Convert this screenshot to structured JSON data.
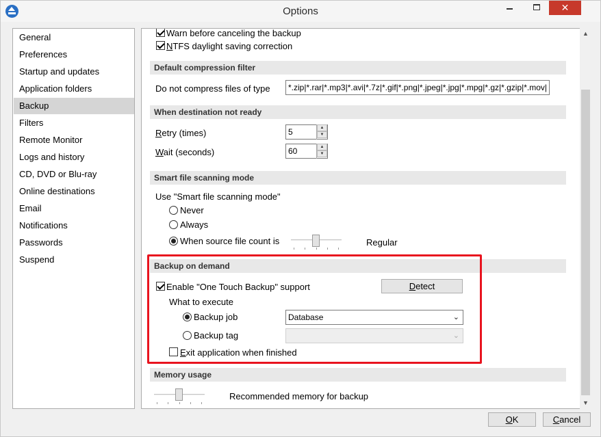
{
  "window": {
    "title": "Options"
  },
  "titlebar": {
    "minimize": "–",
    "maximize": "□",
    "close": "✕"
  },
  "sidebar": {
    "items": [
      {
        "label": "General"
      },
      {
        "label": "Preferences"
      },
      {
        "label": "Startup and updates"
      },
      {
        "label": "Application folders"
      },
      {
        "label": "Backup",
        "selected": true
      },
      {
        "label": "Filters"
      },
      {
        "label": "Remote Monitor"
      },
      {
        "label": "Logs and history"
      },
      {
        "label": "CD, DVD or Blu-ray"
      },
      {
        "label": "Online destinations"
      },
      {
        "label": "Email"
      },
      {
        "label": "Notifications"
      },
      {
        "label": "Passwords"
      },
      {
        "label": "Suspend"
      }
    ]
  },
  "top_options": {
    "warn_cancel": {
      "label": "Warn before canceling the backup",
      "checked": true
    },
    "ntfs_dst": {
      "label": "NTFS daylight saving correction",
      "checked": true
    }
  },
  "compression": {
    "header": "Default compression filter",
    "label": "Do not compress files of type",
    "value": "*.zip|*.rar|*.mp3|*.avi|*.7z|*.gif|*.png|*.jpeg|*.jpg|*.mpg|*.gz|*.gzip|*.mov|"
  },
  "destination": {
    "header": "When destination not ready",
    "retry_label": "Retry (times)",
    "retry_value": "5",
    "wait_label": "Wait (seconds)",
    "wait_value": "60"
  },
  "smart_scan": {
    "header": "Smart file scanning mode",
    "prompt": "Use \"Smart file scanning mode\"",
    "options": [
      "Never",
      "Always",
      "When source file count is"
    ],
    "selected": "When source file count is",
    "slider_text": "Regular"
  },
  "on_demand": {
    "header": "Backup on demand",
    "enable_label": "Enable \"One Touch Backup\" support",
    "enable_checked": true,
    "detect_button": "Detect",
    "what_label": "What to execute",
    "job_label": "Backup job",
    "job_selected": true,
    "job_value": "Database",
    "tag_label": "Backup tag",
    "tag_value": "",
    "exit_label": "Exit application when finished",
    "exit_checked": false
  },
  "memory": {
    "header": "Memory usage",
    "slider_text": "Recommended memory for backup"
  },
  "footer": {
    "ok": "OK",
    "cancel": "Cancel"
  },
  "colors": {
    "highlight": "#e8131e",
    "selected_bg": "#d5d5d5",
    "section_bg": "#e8e8e8"
  }
}
